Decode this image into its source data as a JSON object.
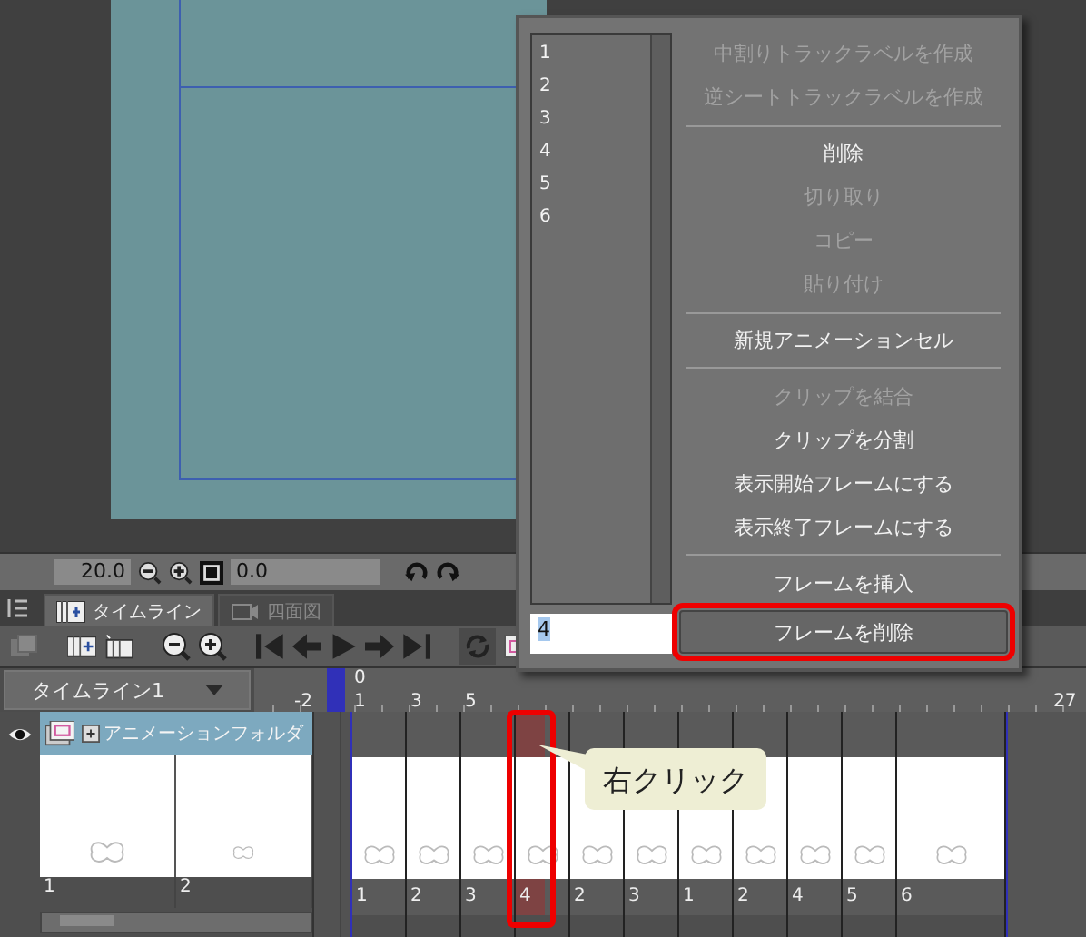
{
  "view_toolbar": {
    "zoom": "20.0",
    "rotation": "0.0"
  },
  "panel_tabs": [
    {
      "label": "タイムライン",
      "selected": true
    },
    {
      "label": "四面図",
      "selected": false
    }
  ],
  "timeline_selector": {
    "value": "タイムライン1"
  },
  "ruler": {
    "labels": [
      "-2",
      "0",
      "1",
      "3",
      "5",
      "27"
    ]
  },
  "track": {
    "name": "アニメーションフォルダ",
    "visible": true,
    "expanded": false,
    "thumbnails": [
      "1",
      "2"
    ]
  },
  "frames": [
    {
      "label": "1",
      "selected": false
    },
    {
      "label": "2",
      "selected": false
    },
    {
      "label": "3",
      "selected": false
    },
    {
      "label": "4",
      "selected": true
    },
    {
      "label": "2",
      "selected": false
    },
    {
      "label": "3",
      "selected": false
    },
    {
      "label": "1",
      "selected": false
    },
    {
      "label": "2",
      "selected": false
    },
    {
      "label": "4",
      "selected": false
    },
    {
      "label": "5",
      "selected": false
    },
    {
      "label": "6",
      "selected": false
    }
  ],
  "callout": "右クリック",
  "context_menu": {
    "cells": [
      "1",
      "2",
      "3",
      "4",
      "5",
      "6"
    ],
    "input_value": "4",
    "items": [
      {
        "kind": "item",
        "label": "中割りトラックラベルを作成",
        "disabled": true,
        "selected": false
      },
      {
        "kind": "item",
        "label": "逆シートトラックラベルを作成",
        "disabled": true,
        "selected": false
      },
      {
        "kind": "separator"
      },
      {
        "kind": "item",
        "label": "削除",
        "disabled": false,
        "selected": false
      },
      {
        "kind": "item",
        "label": "切り取り",
        "disabled": true,
        "selected": false
      },
      {
        "kind": "item",
        "label": "コピー",
        "disabled": true,
        "selected": false
      },
      {
        "kind": "item",
        "label": "貼り付け",
        "disabled": true,
        "selected": false
      },
      {
        "kind": "separator"
      },
      {
        "kind": "item",
        "label": "新規アニメーションセル",
        "disabled": false,
        "selected": false
      },
      {
        "kind": "separator"
      },
      {
        "kind": "item",
        "label": "クリップを結合",
        "disabled": true,
        "selected": false
      },
      {
        "kind": "item",
        "label": "クリップを分割",
        "disabled": false,
        "selected": false
      },
      {
        "kind": "item",
        "label": "表示開始フレームにする",
        "disabled": false,
        "selected": false
      },
      {
        "kind": "item",
        "label": "表示終了フレームにする",
        "disabled": false,
        "selected": false
      },
      {
        "kind": "separator"
      },
      {
        "kind": "item",
        "label": "フレームを挿入",
        "disabled": false,
        "selected": false
      },
      {
        "kind": "item",
        "label": "フレームを削除",
        "disabled": false,
        "selected": true
      }
    ]
  }
}
